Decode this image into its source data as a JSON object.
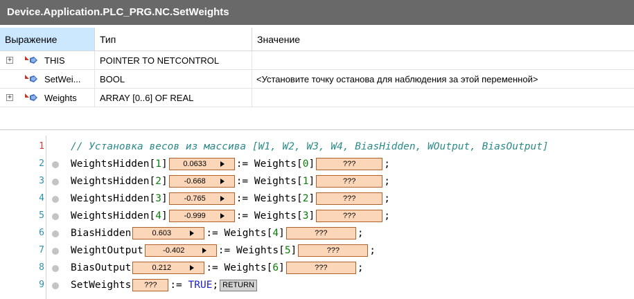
{
  "window": {
    "title": "Device.Application.PLC_PRG.NC.SetWeights"
  },
  "watch": {
    "columns": [
      "Выражение",
      "Тип",
      "Значение"
    ],
    "rows": [
      {
        "name": "THIS",
        "type": "POINTER TO NETCONTROL",
        "value": "",
        "expander": "+"
      },
      {
        "name": "SetWei...",
        "type": "BOOL",
        "value": "<Установите точку останова для наблюдения за этой переменной>",
        "expander": ""
      },
      {
        "name": "Weights",
        "type": "ARRAY [0..6] OF REAL",
        "value": "",
        "expander": "+"
      }
    ]
  },
  "editor": {
    "lines": [
      {
        "num": "1",
        "comment": "// Установка весов из массива [W1, W2, W3, W4, BiasHidden, WOutput, BiasOutput]"
      },
      {
        "num": "2",
        "lhs": "WeightsHidden[",
        "idx": "1",
        "rb": "]",
        "val": "0.0633",
        "op": ":=",
        "rhs": "Weights[",
        "ridx": "0",
        "rrb": "]",
        "rval": "???",
        "end": ";"
      },
      {
        "num": "3",
        "lhs": "WeightsHidden[",
        "idx": "2",
        "rb": "]",
        "val": "-0.668",
        "op": ":=",
        "rhs": "Weights[",
        "ridx": "1",
        "rrb": "]",
        "rval": "???",
        "end": ";"
      },
      {
        "num": "4",
        "lhs": "WeightsHidden[",
        "idx": "3",
        "rb": "]",
        "val": "-0.765",
        "op": ":=",
        "rhs": "Weights[",
        "ridx": "2",
        "rrb": "]",
        "rval": "???",
        "end": ";"
      },
      {
        "num": "5",
        "lhs": "WeightsHidden[",
        "idx": "4",
        "rb": "]",
        "val": "-0.999",
        "op": ":=",
        "rhs": "Weights[",
        "ridx": "3",
        "rrb": "]",
        "rval": "???",
        "end": ";"
      },
      {
        "num": "6",
        "lhs": "BiasHidden",
        "val": "0.603",
        "op": ":=",
        "rhs": "Weights[",
        "ridx": "4",
        "rrb": "]",
        "rval": "???",
        "end": ";"
      },
      {
        "num": "7",
        "lhs": "WeightOutput",
        "val": "-0.402",
        "op": ":=",
        "rhs": "Weights[",
        "ridx": "5",
        "rrb": "]",
        "rval": "???",
        "end": ";"
      },
      {
        "num": "8",
        "lhs": "BiasOutput",
        "val": "0.212",
        "op": ":=",
        "rhs": "Weights[",
        "ridx": "6",
        "rrb": "]",
        "rval": "???",
        "end": ";"
      },
      {
        "num": "9",
        "lhs": "SetWeights",
        "val": "???",
        "op": ":=",
        "kw": "TRUE",
        "end": ";",
        "ret": "RETURN"
      }
    ]
  },
  "colors": {
    "title_bar": "#696969",
    "header_selected": "#cce8ff",
    "inline_value_bg": "#fbd6b8",
    "comment": "#2b8a88",
    "number": "#0a7d0a"
  }
}
